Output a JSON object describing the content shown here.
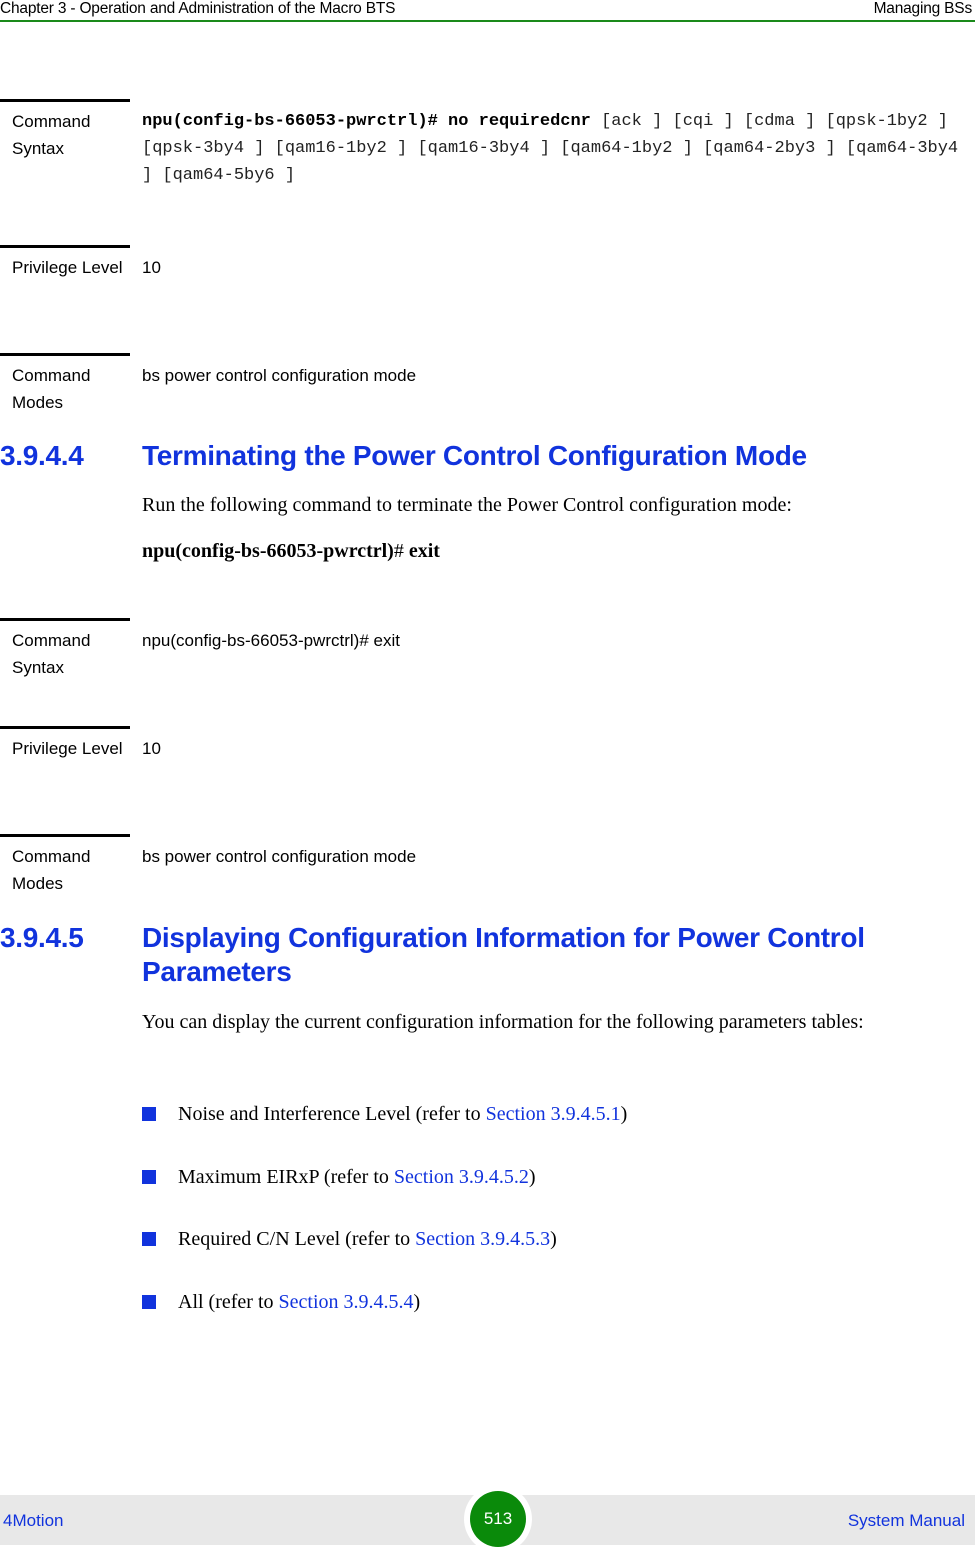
{
  "header": {
    "chapter": "Chapter 3 - Operation and Administration of the Macro BTS",
    "section": "Managing BSs"
  },
  "table1": {
    "syntax_label": "Command Syntax",
    "syntax_bold": "npu(config-bs-66053-pwrctrl)# no requiredcnr",
    "syntax_rest": " [ack ] [cqi ] [cdma ] [qpsk-1by2 ] [qpsk-3by4 ] [qam16-1by2 ] [qam16-3by4 ] [qam64-1by2 ] [qam64-2by3 ] [qam64-3by4 ] [qam64-5by6 ]",
    "privilege_label": "Privilege Level",
    "privilege_value": "10",
    "modes_label": "Command Modes",
    "modes_value": "bs power control configuration mode"
  },
  "section_3_9_4_4": {
    "number": "3.9.4.4",
    "title": "Terminating the Power Control Configuration Mode",
    "intro": "Run the following command to terminate the Power Control configuration mode:",
    "command_prefix": "npu(config-bs-66053-pwrctrl)",
    "command_hash": "#",
    "command_keyword": " exit"
  },
  "table2": {
    "syntax_label": "Command Syntax",
    "syntax_value": "npu(config-bs-66053-pwrctrl)# exit",
    "privilege_label": "Privilege Level",
    "privilege_value": "10",
    "modes_label": "Command Modes",
    "modes_value": "bs power control configuration mode"
  },
  "section_3_9_4_5": {
    "number": "3.9.4.5",
    "title": "Displaying Configuration Information for Power Control Parameters",
    "intro": "You can display the current configuration information for the following parameters tables:",
    "items": [
      {
        "text": "Noise and Interference Level (refer to ",
        "link": "Section 3.9.4.5.1",
        "tail": ")"
      },
      {
        "text": "Maximum EIRxP (refer to ",
        "link": "Section 3.9.4.5.2",
        "tail": ")"
      },
      {
        "text": "Required C/N Level (refer to ",
        "link": "Section 3.9.4.5.3",
        "tail": ")"
      },
      {
        "text": "All (refer to ",
        "link": "Section 3.9.4.5.4",
        "tail": ")"
      }
    ]
  },
  "footer": {
    "left": "4Motion",
    "page": "513",
    "right": "System Manual"
  },
  "colors": {
    "heading_blue": "#1133dd",
    "header_rule_green": "#1a8a1a",
    "page_badge_green": "#0a8a0a",
    "footer_bg": "#e8e8e8"
  }
}
